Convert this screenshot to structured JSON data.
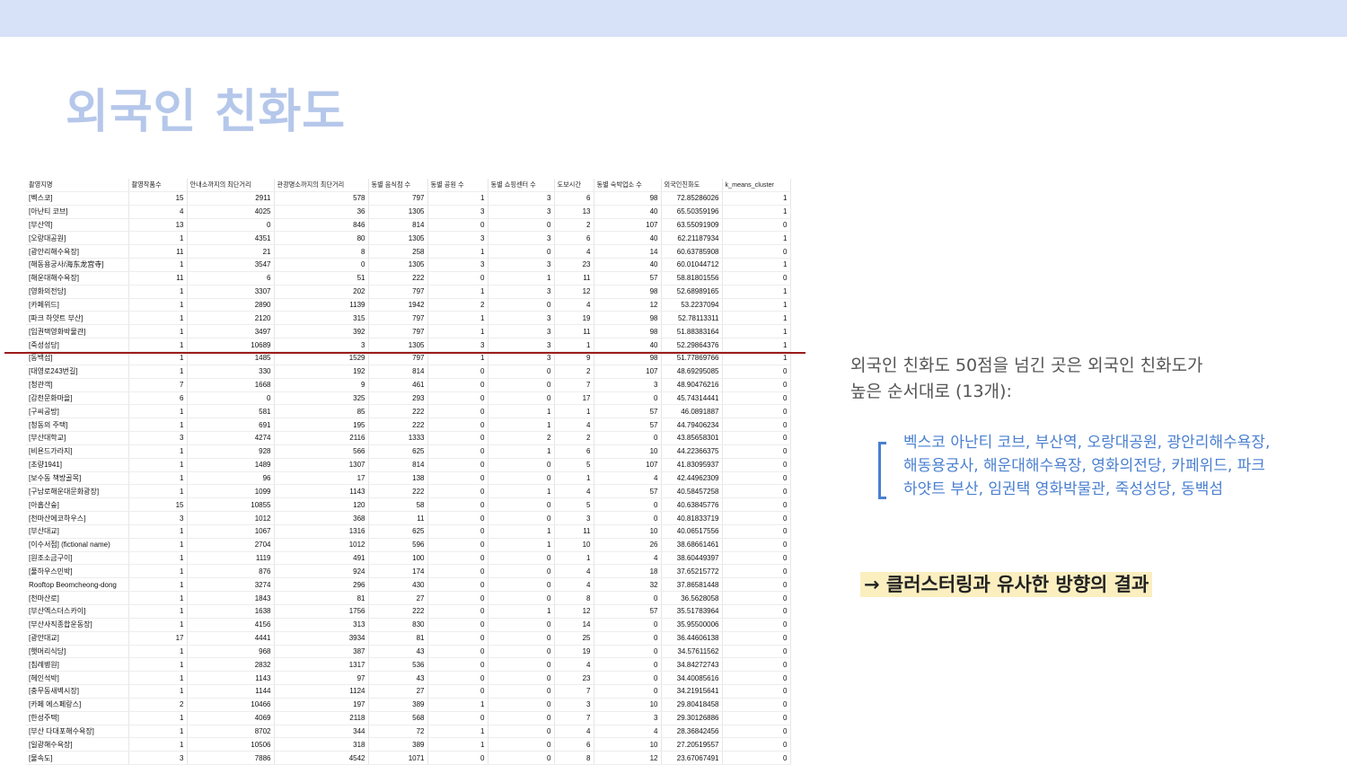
{
  "title": "외국인 친화도",
  "table": {
    "headers": [
      "촬영지명",
      "촬영작품수",
      "안내소까지의 최단거리",
      "관광명소까지의 최단거리",
      "동별 음식점 수",
      "동별 공원 수",
      "동별 쇼핑센터 수",
      "도보시간",
      "동별 숙박업소 수",
      "외국인친화도",
      "k_means_cluster"
    ],
    "rows": [
      [
        "[벡스코]",
        "15",
        "2911",
        "578",
        "797",
        "1",
        "3",
        "6",
        "98",
        "72.85286026",
        "1"
      ],
      [
        "[아난티 코브]",
        "4",
        "4025",
        "36",
        "1305",
        "3",
        "3",
        "13",
        "40",
        "65.50359196",
        "1"
      ],
      [
        "[부산역]",
        "13",
        "0",
        "846",
        "814",
        "0",
        "0",
        "2",
        "107",
        "63.55091909",
        "0"
      ],
      [
        "[오랑대공원]",
        "1",
        "4351",
        "80",
        "1305",
        "3",
        "3",
        "6",
        "40",
        "62.21187934",
        "1"
      ],
      [
        "[광안리해수욕장]",
        "11",
        "21",
        "8",
        "258",
        "1",
        "0",
        "4",
        "14",
        "60.63785908",
        "0"
      ],
      [
        "[해동용궁사/海东龙宫寺]",
        "1",
        "3547",
        "0",
        "1305",
        "3",
        "3",
        "23",
        "40",
        "60.01044712",
        "1"
      ],
      [
        "[해운대해수욕장]",
        "11",
        "6",
        "51",
        "222",
        "0",
        "1",
        "11",
        "57",
        "58.81801556",
        "0"
      ],
      [
        "[영화의전당]",
        "1",
        "3307",
        "202",
        "797",
        "1",
        "3",
        "12",
        "98",
        "52.68989165",
        "1"
      ],
      [
        "[카페위드]",
        "1",
        "2890",
        "1139",
        "1942",
        "2",
        "0",
        "4",
        "12",
        "53.2237094",
        "1"
      ],
      [
        "[파크 하얏트 부산]",
        "1",
        "2120",
        "315",
        "797",
        "1",
        "3",
        "19",
        "98",
        "52.78113311",
        "1"
      ],
      [
        "[임권택영화박물관]",
        "1",
        "3497",
        "392",
        "797",
        "1",
        "3",
        "11",
        "98",
        "51.88383164",
        "1"
      ],
      [
        "[죽성성당]",
        "1",
        "10689",
        "3",
        "1305",
        "3",
        "3",
        "1",
        "40",
        "52.29864376",
        "1"
      ],
      [
        "[동백섬]",
        "1",
        "1485",
        "1529",
        "797",
        "1",
        "3",
        "9",
        "98",
        "51.77869766",
        "1"
      ],
      [
        "[대영로243번길]",
        "1",
        "330",
        "192",
        "814",
        "0",
        "0",
        "2",
        "107",
        "48.69295085",
        "0"
      ],
      [
        "[청관객]",
        "7",
        "1668",
        "9",
        "461",
        "0",
        "0",
        "7",
        "3",
        "48.90476216",
        "0"
      ],
      [
        "[감천문화마을]",
        "6",
        "0",
        "325",
        "293",
        "0",
        "0",
        "17",
        "0",
        "45.74314441",
        "0"
      ],
      [
        "[구씨공방]",
        "1",
        "581",
        "85",
        "222",
        "0",
        "1",
        "1",
        "57",
        "46.0891887",
        "0"
      ],
      [
        "[청동의 주택]",
        "1",
        "691",
        "195",
        "222",
        "0",
        "1",
        "4",
        "57",
        "44.79406234",
        "0"
      ],
      [
        "[부산대학교]",
        "3",
        "4274",
        "2116",
        "1333",
        "0",
        "2",
        "2",
        "0",
        "43.85658301",
        "0"
      ],
      [
        "[비욘드가라지]",
        "1",
        "928",
        "566",
        "625",
        "0",
        "1",
        "6",
        "10",
        "44.22366375",
        "0"
      ],
      [
        "[초량1941]",
        "1",
        "1489",
        "1307",
        "814",
        "0",
        "0",
        "5",
        "107",
        "41.83095937",
        "0"
      ],
      [
        "[보수동 책방골목]",
        "1",
        "96",
        "17",
        "138",
        "0",
        "0",
        "1",
        "4",
        "42.44962309",
        "0"
      ],
      [
        "[구남로해운대문화광장]",
        "1",
        "1099",
        "1143",
        "222",
        "0",
        "1",
        "4",
        "57",
        "40.58457258",
        "0"
      ],
      [
        "[아홉산숲]",
        "15",
        "10855",
        "120",
        "58",
        "0",
        "0",
        "5",
        "0",
        "40.63845776",
        "0"
      ],
      [
        "[천마산에코하우스]",
        "3",
        "1012",
        "368",
        "11",
        "0",
        "0",
        "3",
        "0",
        "40.81833719",
        "0"
      ],
      [
        "[부산대교]",
        "1",
        "1067",
        "1316",
        "625",
        "0",
        "1",
        "11",
        "10",
        "40.06517556",
        "0"
      ],
      [
        "[이수서점] (fictional name)",
        "1",
        "2704",
        "1012",
        "596",
        "0",
        "1",
        "10",
        "26",
        "38.68661461",
        "0"
      ],
      [
        "[원조소금구이]",
        "1",
        "1119",
        "491",
        "100",
        "0",
        "0",
        "1",
        "4",
        "38.60449397",
        "0"
      ],
      [
        "[풀하우스민박]",
        "1",
        "876",
        "924",
        "174",
        "0",
        "0",
        "4",
        "18",
        "37.65215772",
        "0"
      ],
      [
        "Rooftop Beomcheong-dong",
        "1",
        "3274",
        "296",
        "430",
        "0",
        "0",
        "4",
        "32",
        "37.86581448",
        "0"
      ],
      [
        "[천마산로]",
        "1",
        "1843",
        "81",
        "27",
        "0",
        "0",
        "8",
        "0",
        "36.5628058",
        "0"
      ],
      [
        "[부산엑스더스카이]",
        "1",
        "1638",
        "1756",
        "222",
        "0",
        "1",
        "12",
        "57",
        "35.51783964",
        "0"
      ],
      [
        "[부산사직종합운동장]",
        "1",
        "4156",
        "313",
        "830",
        "0",
        "0",
        "14",
        "0",
        "35.95500006",
        "0"
      ],
      [
        "[광안대교]",
        "17",
        "4441",
        "3934",
        "81",
        "0",
        "0",
        "25",
        "0",
        "36.44606138",
        "0"
      ],
      [
        "[햇머리식당]",
        "1",
        "968",
        "387",
        "43",
        "0",
        "0",
        "19",
        "0",
        "34.57611562",
        "0"
      ],
      [
        "[침례병원]",
        "1",
        "2832",
        "1317",
        "536",
        "0",
        "0",
        "4",
        "0",
        "34.84272743",
        "0"
      ],
      [
        "[헤인석박]",
        "1",
        "1143",
        "97",
        "43",
        "0",
        "0",
        "23",
        "0",
        "34.40085616",
        "0"
      ],
      [
        "[충무동새벽시장]",
        "1",
        "1144",
        "1124",
        "27",
        "0",
        "0",
        "7",
        "0",
        "34.21915641",
        "0"
      ],
      [
        "[카페 에스페랑스]",
        "2",
        "10466",
        "197",
        "389",
        "1",
        "0",
        "3",
        "10",
        "29.80418458",
        "0"
      ],
      [
        "[한성주택]",
        "1",
        "4069",
        "2118",
        "568",
        "0",
        "0",
        "7",
        "3",
        "29.30126886",
        "0"
      ],
      [
        "[부산 다대포해수욕장]",
        "1",
        "8702",
        "344",
        "72",
        "1",
        "0",
        "4",
        "4",
        "28.36842456",
        "0"
      ],
      [
        "[일광해수욕장]",
        "1",
        "10506",
        "318",
        "389",
        "1",
        "0",
        "6",
        "10",
        "27.20519557",
        "0"
      ],
      [
        "[물속도]",
        "3",
        "7886",
        "4542",
        "1071",
        "0",
        "0",
        "8",
        "12",
        "23.67067491",
        "0"
      ]
    ]
  },
  "description": {
    "line1": "외국인 친화도 50점을 넘긴 곳은 외국인 친화도가",
    "line2": "높은 순서대로 (13개):"
  },
  "highlight_list": {
    "line1": "벡스코 아난티 코브, 부산역, 오랑대공원, 광안리해수욕장,",
    "line2": "해동용궁사, 해운대해수욕장, 영화의전당, 카페위드, 파크",
    "line3": "하얏트 부산, 임권택 영화박물관, 죽성성당, 동백섬"
  },
  "conclusion": "→ 클러스터링과 유사한 방향의 결과",
  "colors": {
    "topbar": "#d7e1f7",
    "title": "#b5c7ea",
    "divider": "#9b1b1b",
    "list_text": "#4a7fd0",
    "conclusion_bg": "#fbefc0"
  }
}
